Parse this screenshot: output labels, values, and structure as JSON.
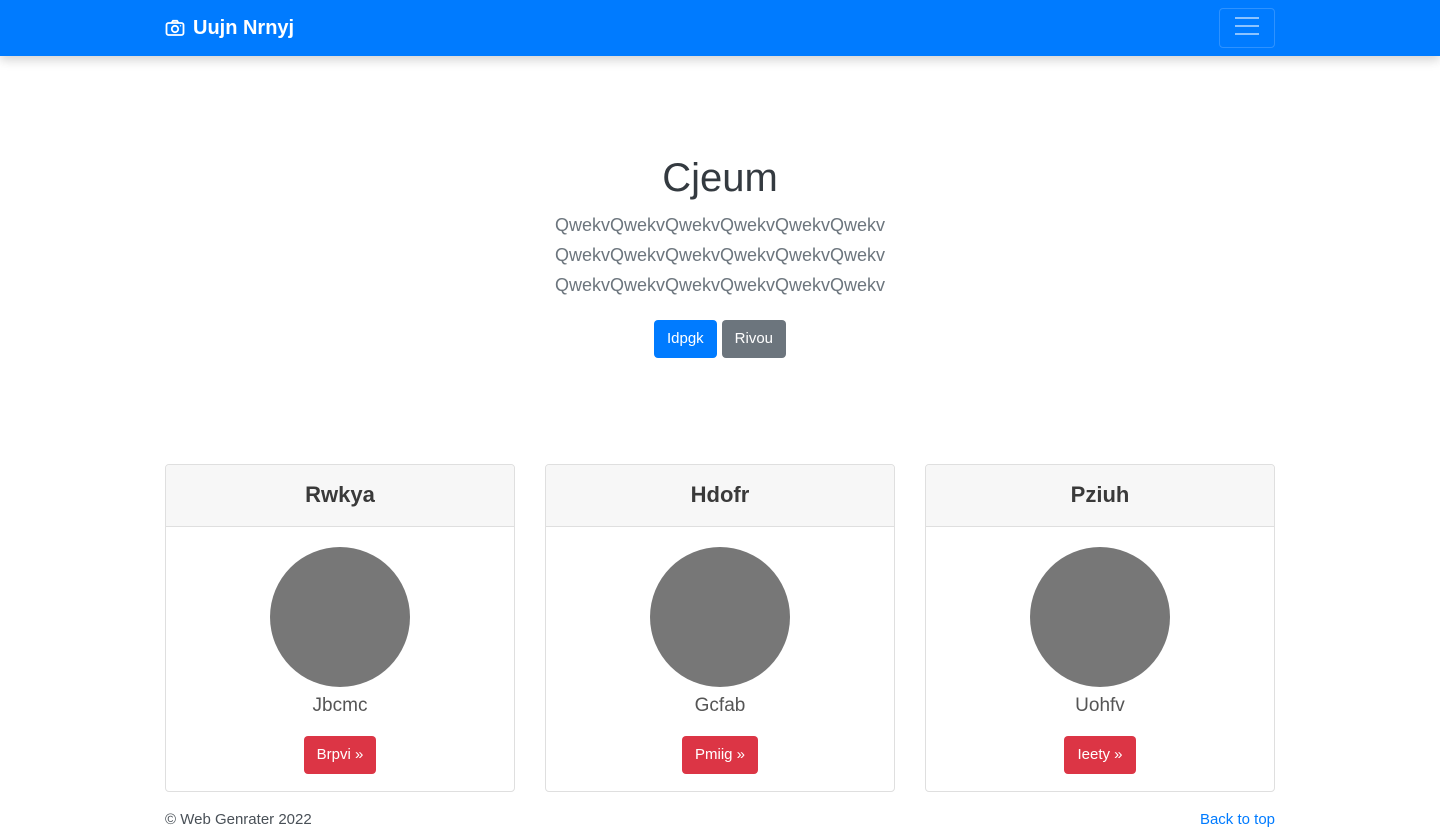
{
  "navbar": {
    "brand": "Uujn Nrnyj",
    "brand_icon": "camera-icon",
    "toggler_icon": "hamburger-menu-icon",
    "color": "#007bff"
  },
  "hero": {
    "title": "Cjeum",
    "lead_lines": [
      "QwekvQwekvQwekvQwekvQwekvQwekv",
      "QwekvQwekvQwekvQwekvQwekvQwekv",
      "QwekvQwekvQwekvQwekvQwekvQwekv"
    ],
    "primary_button": "Idpgk",
    "secondary_button": "Rivou"
  },
  "cards": [
    {
      "title": "Rwkya",
      "name": "Jbcmc",
      "button": "Brpvi »"
    },
    {
      "title": "Hdofr",
      "name": "Gcfab",
      "button": "Pmiig »"
    },
    {
      "title": "Pziuh",
      "name": "Uohfv",
      "button": "Ieety »"
    }
  ],
  "footer": {
    "copyright": "© Web Genrater 2022",
    "back_to_top": "Back to top"
  }
}
